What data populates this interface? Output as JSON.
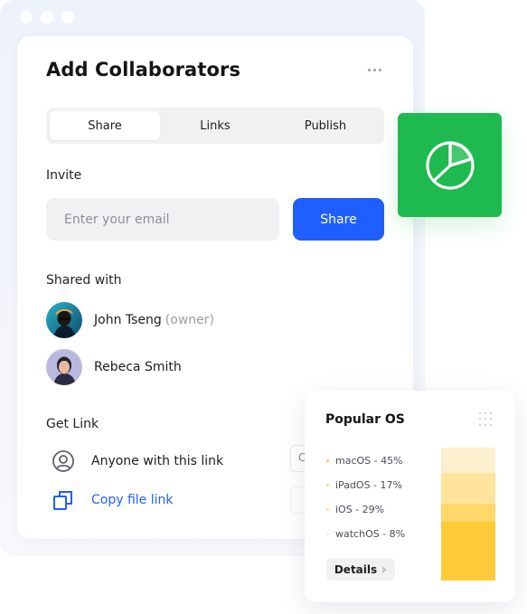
{
  "window": {
    "controls": [
      "close",
      "minimize",
      "maximize"
    ]
  },
  "dialog": {
    "title": "Add Collaborators",
    "more_icon": "more-horizontal-icon",
    "tabs": [
      {
        "label": "Share",
        "active": true
      },
      {
        "label": "Links",
        "active": false
      },
      {
        "label": "Publish",
        "active": false
      }
    ],
    "invite": {
      "label": "Invite",
      "email_placeholder": "Enter your email",
      "email_value": "",
      "share_label": "Share"
    },
    "shared_with": {
      "label": "Shared with",
      "people": [
        {
          "name": "John Tseng",
          "role": "(owner)",
          "avatar": "avatar-john"
        },
        {
          "name": "Rebeca Smith",
          "role": "",
          "avatar": "avatar-rebeca"
        }
      ]
    },
    "get_link": {
      "label": "Get Link",
      "access_text": "Anyone with this link",
      "access_icon": "user-circle-icon",
      "copy_text": "Copy file link",
      "copy_icon": "copy-icon"
    }
  },
  "pie_tile": {
    "icon": "pie-chart-icon",
    "color": "#1fba4f"
  },
  "popular_os": {
    "title": "Popular OS",
    "grip_icon": "grip-dots-icon",
    "details_label": "Details",
    "details_icon": "chevron-right-icon"
  },
  "chart_data": {
    "type": "bar",
    "title": "Popular OS",
    "stacked": true,
    "categories": [
      "macOS",
      "iPadOS",
      "iOS",
      "watchOS"
    ],
    "series": [
      {
        "name": "macOS",
        "label": "macOS - 45%",
        "value": 45,
        "color": "#fcefcd"
      },
      {
        "name": "iPadOS",
        "label": "iPadOS - 17%",
        "value": 17,
        "color": "#ffe49e"
      },
      {
        "name": "iOS",
        "label": "iOS - 29%",
        "value": 29,
        "color": "#ffd86a"
      },
      {
        "name": "watchOS",
        "label": "watchOS - 8%",
        "value": 8,
        "color": "#ffcb39"
      }
    ],
    "bar_fractions": [
      0.19,
      0.23,
      0.14,
      0.44
    ],
    "legend": "left"
  },
  "colors": {
    "accent": "#1f5eff",
    "green": "#1fba4f",
    "yellow": "#ffcb39"
  }
}
